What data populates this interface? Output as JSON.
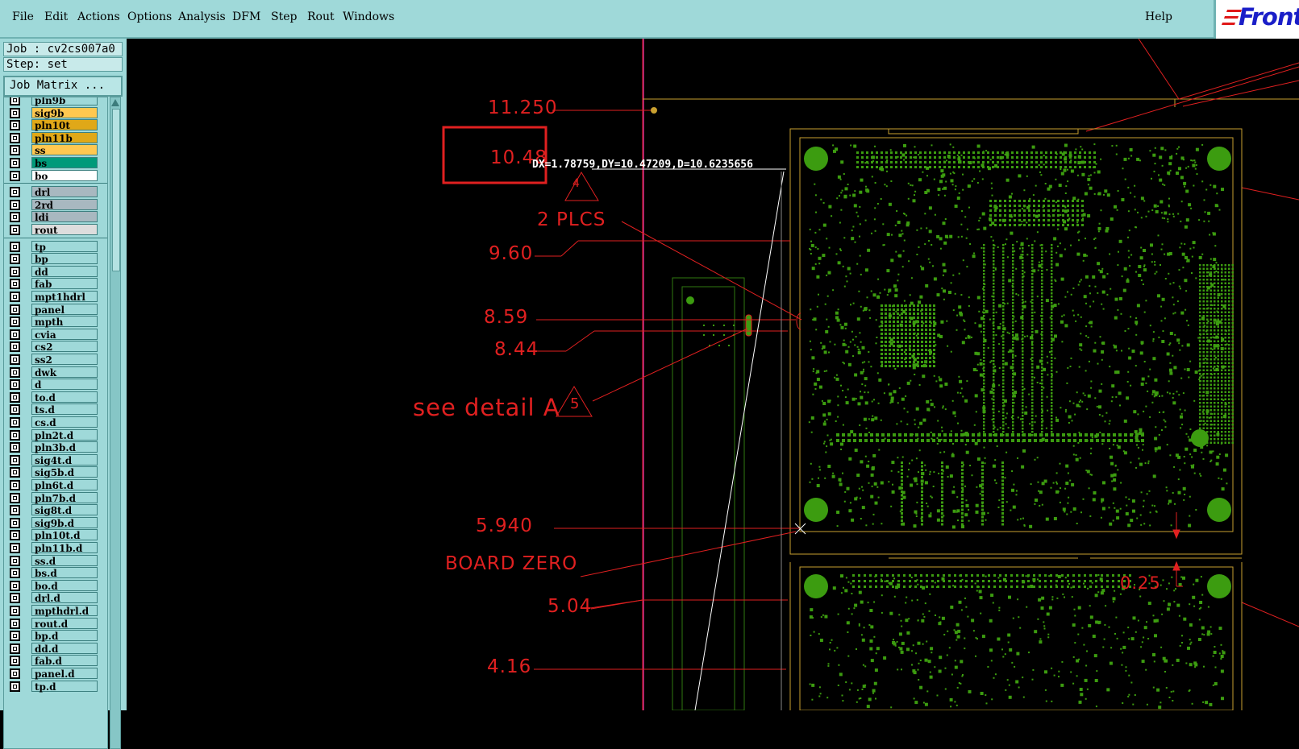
{
  "menu": {
    "items": [
      "File",
      "Edit",
      "Actions",
      "Options",
      "Analysis",
      "DFM",
      "Step",
      "Rout",
      "Windows"
    ],
    "help": "Help",
    "logo": "Front"
  },
  "job": {
    "job_line": "Job : cv2cs007a0",
    "step_line": "Step: set",
    "matrix_button": "Job Matrix ..."
  },
  "layers": {
    "group1": [
      {
        "name": "pln9b",
        "color": "#9fd9d9"
      },
      {
        "name": "sig9b",
        "color": "#ffc850"
      },
      {
        "name": "pln10t",
        "color": "#e0a818"
      },
      {
        "name": "pln11b",
        "color": "#e0a818"
      },
      {
        "name": "ss",
        "color": "#ffc850"
      },
      {
        "name": "bs",
        "color": "#009a7a"
      },
      {
        "name": "bo",
        "color": "#ffffff"
      }
    ],
    "group2": [
      {
        "name": "drl",
        "color": "#a8b8c0"
      },
      {
        "name": "2rd",
        "color": "#a8b8c0"
      },
      {
        "name": "ldi",
        "color": "#a8b8c0"
      },
      {
        "name": "rout",
        "color": "#dddddd"
      }
    ],
    "group3": [
      "tp",
      "bp",
      "dd",
      "fab",
      "mpt1hdrl",
      "panel",
      "mpth",
      "cvia",
      "cs2",
      "ss2",
      "dwk",
      "d",
      "to.d",
      "ts.d",
      "cs.d",
      "pln2t.d",
      "pln3b.d",
      "sig4t.d",
      "sig5b.d",
      "pln6t.d",
      "pln7b.d",
      "sig8t.d",
      "sig9b.d",
      "pln10t.d",
      "pln11b.d",
      "ss.d",
      "bs.d",
      "bo.d",
      "drl.d",
      "mpthdrl.d",
      "rout.d",
      "bp.d",
      "dd.d",
      "fab.d",
      "panel.d",
      "tp.d"
    ],
    "default_color": "#9fd9d9"
  },
  "drawing": {
    "dims": [
      "11.250",
      "10.48",
      "9.60",
      "8.59",
      "8.44",
      "5.940",
      "5.04",
      "4.16",
      "0.25"
    ],
    "plcs": "2 PLCS",
    "detail": "see detail A",
    "tri4": "4",
    "tri5": "5",
    "board_zero": "BOARD ZERO",
    "measurement": "DX=1.78759,DY=10.47209,D=10.6235656"
  },
  "colors": {
    "menu_bg": "#9fd9d9",
    "dimension_red": "#e02020",
    "board_outline": "#c8a030",
    "pad_green": "#3c9c10",
    "profile_magenta": "#ff3cc8"
  }
}
